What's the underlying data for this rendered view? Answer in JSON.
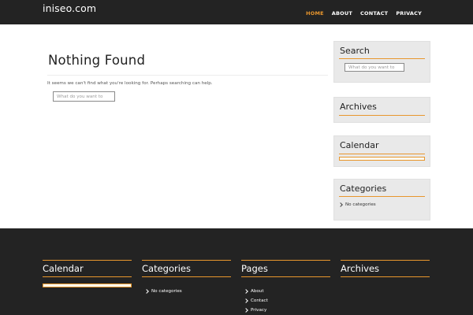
{
  "header": {
    "site_title": "iniseo.com",
    "nav": [
      {
        "label": "HOME",
        "active": true
      },
      {
        "label": "ABOUT",
        "active": false
      },
      {
        "label": "CONTACT",
        "active": false
      },
      {
        "label": "PRIVACY",
        "active": false
      }
    ]
  },
  "main": {
    "title": "Nothing Found",
    "message": "It seems we can't find what you're looking for. Perhaps searching can help.",
    "search_placeholder": "What do you want to"
  },
  "sidebar": {
    "search": {
      "title": "Search",
      "placeholder": "What do you want to"
    },
    "archives": {
      "title": "Archives"
    },
    "calendar": {
      "title": "Calendar"
    },
    "categories": {
      "title": "Categories",
      "items": [
        "No categories"
      ]
    }
  },
  "footer": {
    "calendar": {
      "title": "Calendar"
    },
    "categories": {
      "title": "Categories",
      "items": [
        "No categories"
      ]
    },
    "pages": {
      "title": "Pages",
      "items": [
        "About",
        "Contact",
        "Privacy"
      ]
    },
    "archives": {
      "title": "Archives"
    }
  },
  "colors": {
    "accent": "#e8962d",
    "header_bg": "#232323",
    "widget_bg": "#e9e9e9"
  }
}
